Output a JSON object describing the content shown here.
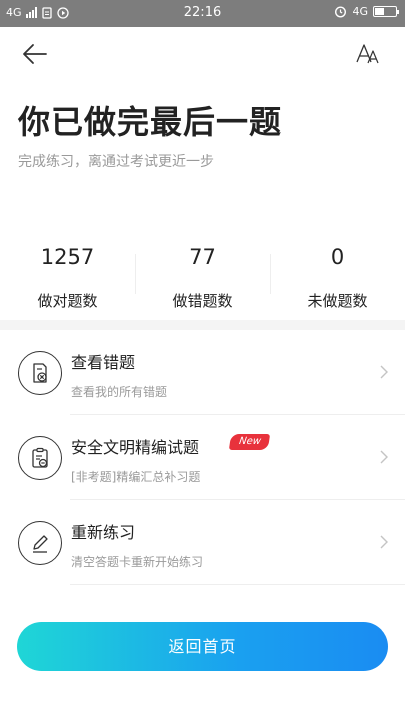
{
  "status_bar": {
    "network_left": "4G",
    "time": "22:16",
    "network_right": "4G",
    "battery_level": 0.45,
    "icons": [
      "signal-icon",
      "sim-icon",
      "play-icon",
      "alarm-icon",
      "battery-icon"
    ]
  },
  "nav": {
    "back_icon": "back-arrow-icon",
    "font_icon": "font-size-icon"
  },
  "header": {
    "title": "你已做完最后一题",
    "subtitle": "完成练习，离通过考试更近一步"
  },
  "stats": [
    {
      "value": "1257",
      "label": "做对题数"
    },
    {
      "value": "77",
      "label": "做错题数"
    },
    {
      "value": "0",
      "label": "未做题数"
    }
  ],
  "menu": [
    {
      "title": "查看错题",
      "subtitle": "查看我的所有错题",
      "icon": "wrong-doc-icon"
    },
    {
      "title": "安全文明精编试题",
      "subtitle": "[非考题]精编汇总补习题",
      "icon": "clipboard-icon",
      "badge": "New"
    },
    {
      "title": "重新练习",
      "subtitle": "清空答题卡重新开始练习",
      "icon": "pencil-icon"
    }
  ],
  "button": {
    "label": "返回首页"
  },
  "colors": {
    "button_gradient_start": "#1fd6d6",
    "button_gradient_end": "#1a8cf2",
    "badge": "#e8323c",
    "status_bar": "#7d7d7d"
  }
}
